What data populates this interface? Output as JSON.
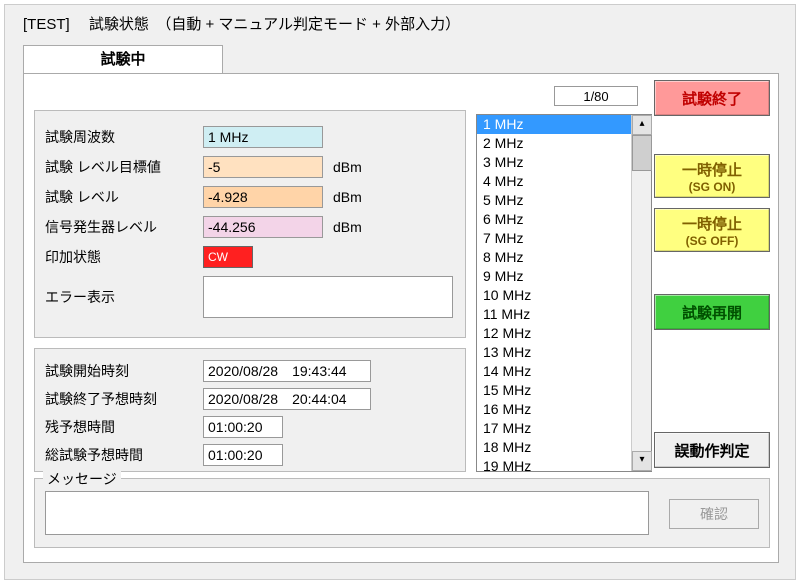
{
  "title": "[TEST]　 試験状態　（自動 + マニュアル判定モード + 外部入力）",
  "tab": "試験中",
  "counter": "1/80",
  "params": {
    "freq": {
      "label": "試験周波数",
      "value": "1 MHz",
      "unit": ""
    },
    "target": {
      "label": "試験 レベル目標値",
      "value": "-5",
      "unit": "dBm"
    },
    "level": {
      "label": "試験 レベル",
      "value": "-4.928",
      "unit": "dBm"
    },
    "sg": {
      "label": "信号発生器レベル",
      "value": "-44.256",
      "unit": "dBm"
    },
    "apply": {
      "label": "印加状態",
      "value": "CW"
    },
    "error": {
      "label": "エラー表示",
      "value": ""
    }
  },
  "times": {
    "start": {
      "label": "試験開始時刻",
      "value": "2020/08/28　19:43:44"
    },
    "end": {
      "label": "試験終了予想時刻",
      "value": "2020/08/28　20:44:04"
    },
    "remain": {
      "label": "残予想時間",
      "value": "01:00:20"
    },
    "total": {
      "label": "総試験予想時間",
      "value": "01:00:20"
    }
  },
  "freqlist": [
    "1 MHz",
    "2 MHz",
    "3 MHz",
    "4 MHz",
    "5 MHz",
    "6 MHz",
    "7 MHz",
    "8 MHz",
    "9 MHz",
    "10 MHz",
    "11 MHz",
    "12 MHz",
    "13 MHz",
    "14 MHz",
    "15 MHz",
    "16 MHz",
    "17 MHz",
    "18 MHz",
    "19 MHz"
  ],
  "freq_selected_index": 0,
  "buttons": {
    "end": "試験終了",
    "pause_on_l1": "一時停止",
    "pause_on_l2": "(SG ON)",
    "pause_off_l1": "一時停止",
    "pause_off_l2": "(SG OFF)",
    "resume": "試験再開",
    "judge": "誤動作判定",
    "confirm": "確認"
  },
  "message": {
    "label": "メッセージ",
    "value": ""
  }
}
